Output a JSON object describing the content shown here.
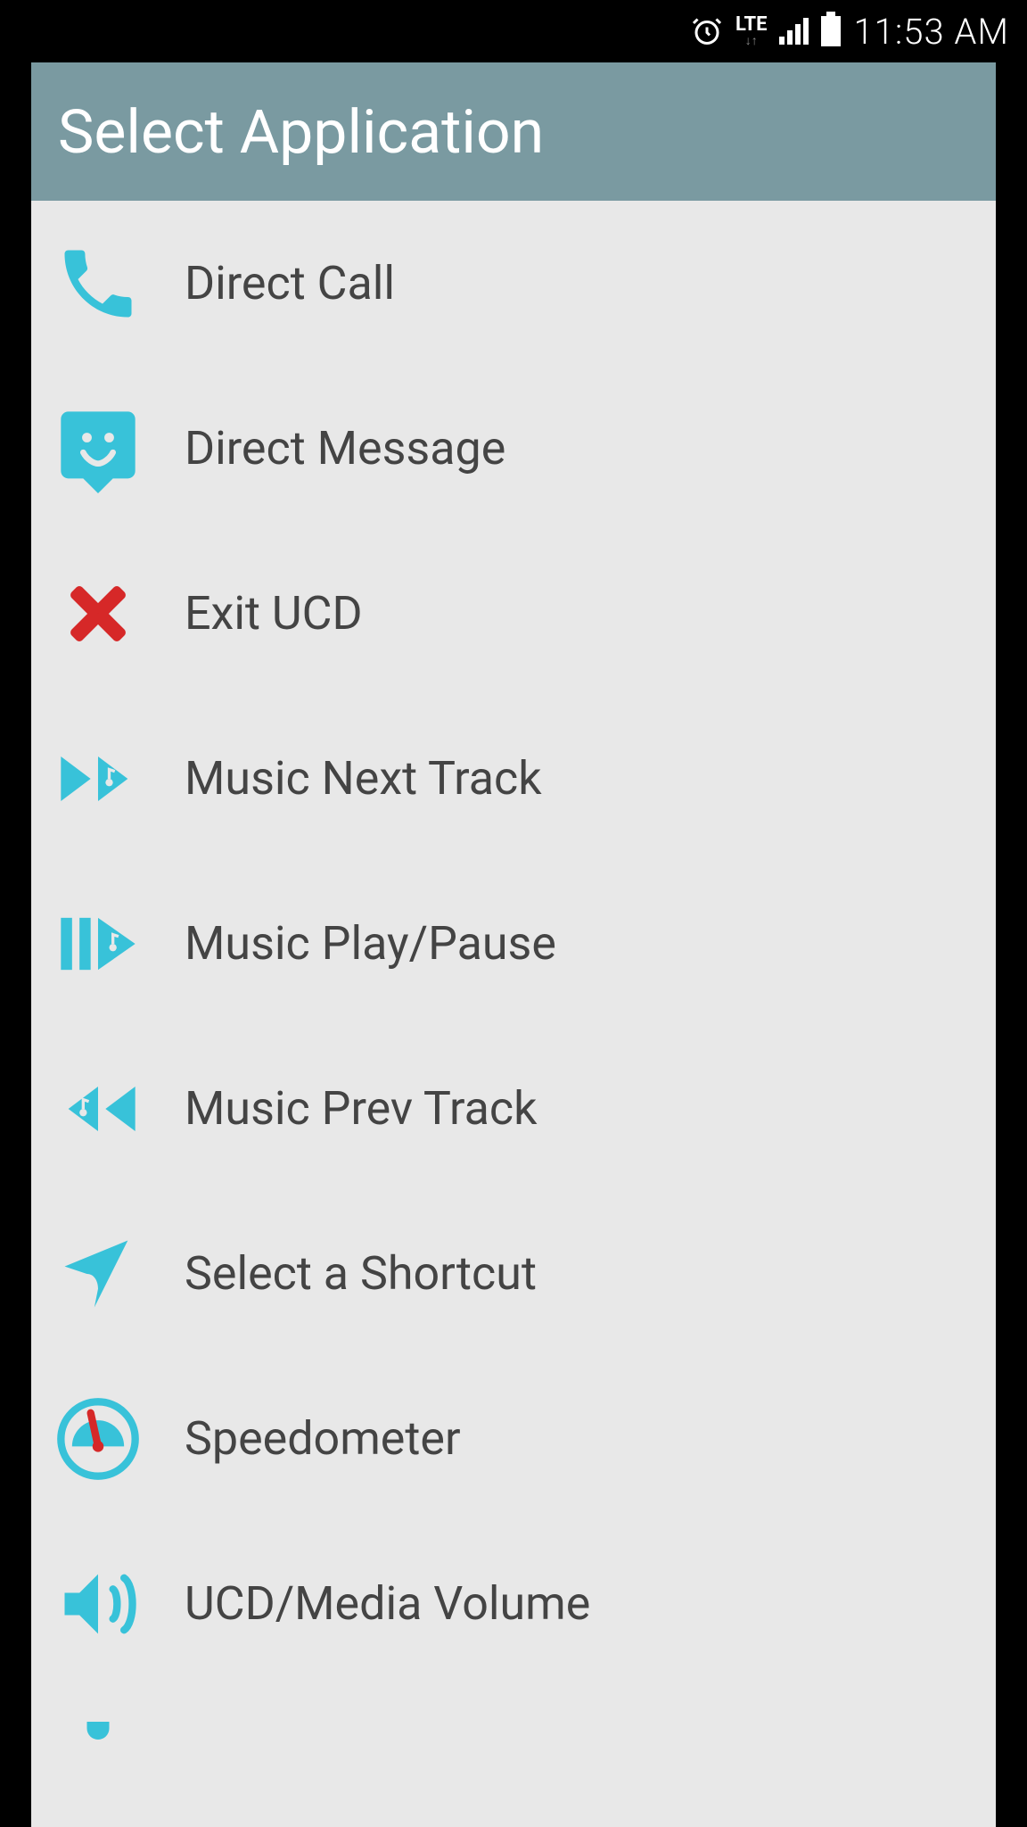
{
  "status_bar": {
    "network_label": "LTE",
    "time": "11:53 AM"
  },
  "modal": {
    "title": "Select Application",
    "items": [
      {
        "icon": "phone-icon",
        "label": "Direct Call"
      },
      {
        "icon": "message-icon",
        "label": "Direct Message"
      },
      {
        "icon": "exit-icon",
        "label": "Exit UCD"
      },
      {
        "icon": "next-track-icon",
        "label": "Music Next Track"
      },
      {
        "icon": "play-pause-icon",
        "label": "Music Play/Pause"
      },
      {
        "icon": "prev-track-icon",
        "label": "Music Prev Track"
      },
      {
        "icon": "shortcut-arrow-icon",
        "label": "Select a Shortcut"
      },
      {
        "icon": "speedometer-icon",
        "label": "Speedometer"
      },
      {
        "icon": "volume-icon",
        "label": "UCD/Media Volume"
      }
    ]
  },
  "colors": {
    "accent_teal": "#38c2d9",
    "header_teal": "#7a9aa1",
    "exit_red": "#d62828"
  }
}
